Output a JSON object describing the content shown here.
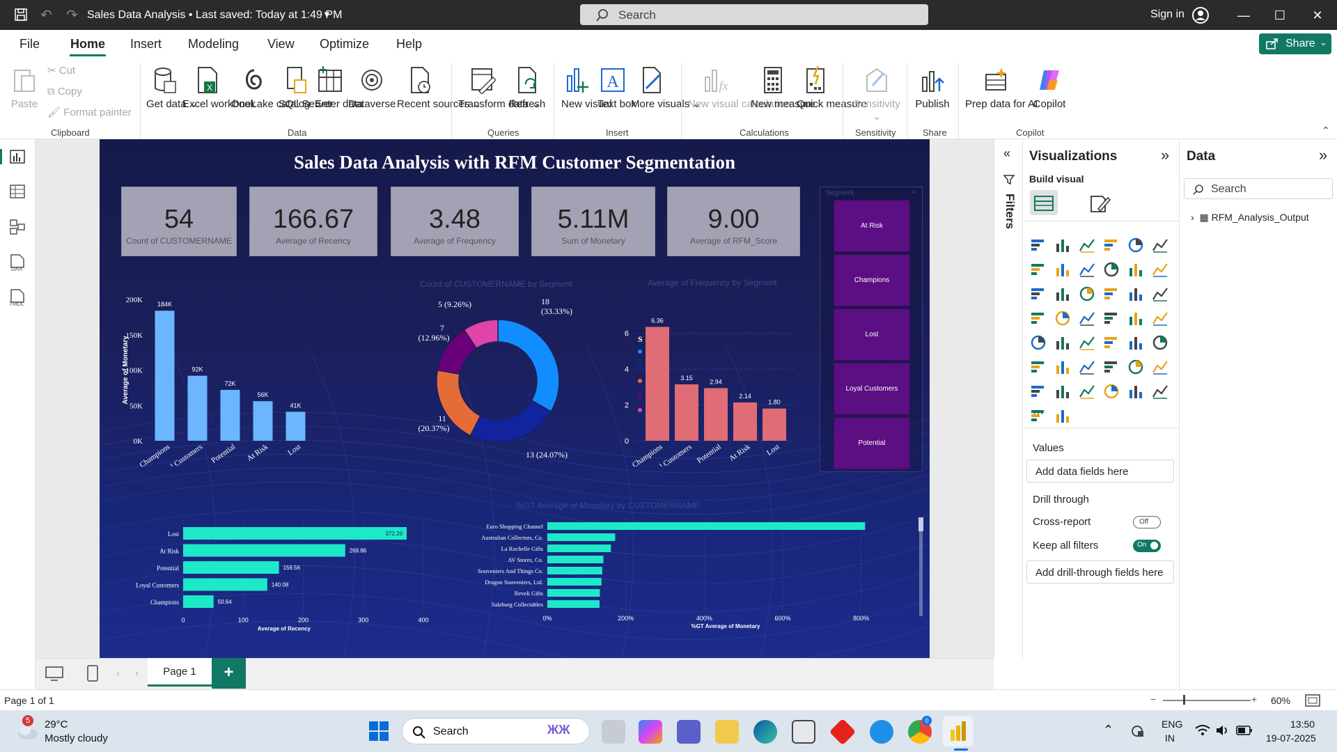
{
  "titlebar": {
    "title": "Sales Data Analysis • Last saved: Today at 1:49 PM",
    "search_placeholder": "Search",
    "sign_in": "Sign in"
  },
  "menu": {
    "items": [
      "File",
      "Home",
      "Insert",
      "Modeling",
      "View",
      "Optimize",
      "Help"
    ],
    "active": "Home",
    "share": "Share"
  },
  "ribbon": {
    "clipboard": {
      "paste": "Paste",
      "cut": "Cut",
      "copy": "Copy",
      "format_painter": "Format painter",
      "group": "Clipboard"
    },
    "data": {
      "get_data": "Get data",
      "excel": "Excel workbook",
      "onelake": "OneLake catalog",
      "sql": "SQL Server",
      "enter": "Enter data",
      "dataverse": "Dataverse",
      "recent": "Recent sources",
      "group": "Data"
    },
    "queries": {
      "transform": "Transform data",
      "refresh": "Refresh",
      "group": "Queries"
    },
    "insert": {
      "new_visual": "New visual",
      "text_box": "Text box",
      "more_visuals": "More visuals",
      "group": "Insert"
    },
    "calculations": {
      "new_visual_calc": "New visual calculation",
      "new_measure": "New measure",
      "quick_measure": "Quick measure",
      "group": "Calculations"
    },
    "sensitivity": {
      "label": "Sensitivity",
      "group": "Sensitivity"
    },
    "share": {
      "publish": "Publish",
      "group": "Share"
    },
    "copilot": {
      "prep": "Prep data for AI",
      "copilot": "Copilot",
      "group": "Copilot"
    }
  },
  "report": {
    "title": "Sales Data Analysis with RFM Customer Segmentation",
    "cards": [
      {
        "value": "54",
        "label": "Count of CUSTOMERNAME"
      },
      {
        "value": "166.67",
        "label": "Average of Recency"
      },
      {
        "value": "3.48",
        "label": "Average of Frequency"
      },
      {
        "value": "5.11M",
        "label": "Sum of Monetary"
      },
      {
        "value": "9.00",
        "label": "Average of RFM_Score"
      }
    ],
    "slicer": {
      "title": "Segment",
      "items": [
        "At Risk",
        "Champions",
        "Lost",
        "Loyal Customers",
        "Potential"
      ]
    }
  },
  "chart_data": [
    {
      "type": "bar",
      "title": "",
      "ylabel": "Average of Monetary",
      "categories": [
        "Champions",
        "Loyal Customers",
        "Potential",
        "At Risk",
        "Lost"
      ],
      "values": [
        184,
        92,
        72,
        56,
        41
      ],
      "data_labels": [
        "184K",
        "92K",
        "72K",
        "56K",
        "41K"
      ],
      "y_ticks": [
        "0K",
        "50K",
        "100K",
        "150K",
        "200K"
      ],
      "ylim": [
        0,
        200
      ],
      "color": "#6cb6ff"
    },
    {
      "type": "pie",
      "title": "Count of CUSTOMERNAME by Segment",
      "legend_title": "Segment",
      "legend_position": "right",
      "categories": [
        "Potential",
        "Loyal Customers",
        "Champions",
        "At Risk",
        "Lost"
      ],
      "values": [
        18,
        13,
        11,
        7,
        5
      ],
      "data_labels": [
        "18 (33.33%)",
        "13 (24.07%)",
        "11 (20.37%)",
        "7 (12.96%)",
        "5 (9.26%)"
      ],
      "colors": [
        "#118dff",
        "#12239e",
        "#e66c37",
        "#6b007b",
        "#e044a7"
      ]
    },
    {
      "type": "bar",
      "title": "Average of Frequency by Segment",
      "categories": [
        "Champions",
        "Loyal Customers",
        "Potential",
        "At Risk",
        "Lost"
      ],
      "values": [
        6.36,
        3.15,
        2.94,
        2.14,
        1.8
      ],
      "data_labels": [
        "6.36",
        "3.15",
        "2.94",
        "2.14",
        "1.80"
      ],
      "y_ticks": [
        "0",
        "2",
        "4",
        "6"
      ],
      "ylim": [
        0,
        7
      ],
      "color": "#e06c75"
    },
    {
      "type": "bar",
      "orientation": "horizontal",
      "xlabel": "Average of Recency",
      "categories": [
        "Lost",
        "At Risk",
        "Potential",
        "Loyal Customers",
        "Champions"
      ],
      "values": [
        372.2,
        269.86,
        159.56,
        140.08,
        50.64
      ],
      "data_labels": [
        "372.20",
        "269.86",
        "159.56",
        "140.08",
        "50.64"
      ],
      "x_ticks": [
        "0",
        "100",
        "200",
        "300",
        "400"
      ],
      "xlim": [
        0,
        400
      ],
      "color": "#1de9c8"
    },
    {
      "type": "bar",
      "orientation": "horizontal",
      "title": "%GT Average of Monetary by CUSTOMERNAME",
      "xlabel": "%GT Average of Monetary",
      "categories": [
        "Euro Shopping Channel",
        "Australian Collectors, Co.",
        "La Rochelle Gifts",
        "AV Stores, Co.",
        "Souveniers And Things Co.",
        "Dragon Souveniers, Ltd.",
        "Reveli Gifts",
        "Salzburg Collectables"
      ],
      "values": [
        810,
        173,
        162,
        143,
        140,
        138,
        134,
        133
      ],
      "x_ticks": [
        "0%",
        "200%",
        "400%",
        "600%",
        "800%"
      ],
      "xlim": [
        0,
        900
      ],
      "color": "#1de9c8"
    }
  ],
  "pages": {
    "tab": "Page 1",
    "status": "Page 1 of 1",
    "zoom": "60%"
  },
  "filters": {
    "label": "Filters"
  },
  "visualizations": {
    "title": "Visualizations",
    "build_visual": "Build visual",
    "values": "Values",
    "add_data_fields": "Add data fields here",
    "drill_through": "Drill through",
    "cross_report": "Cross-report",
    "cross_report_state": "Off",
    "keep_all_filters": "Keep all filters",
    "keep_all_filters_state": "On",
    "add_drill_fields": "Add drill-through fields here"
  },
  "data_pane": {
    "title": "Data",
    "search_placeholder": "Search",
    "table": "RFM_Analysis_Output"
  },
  "taskbar": {
    "weather_badge": "5",
    "temperature": "29°C",
    "weather": "Mostly cloudy",
    "search": "Search",
    "lang1": "ENG",
    "lang2": "IN",
    "time": "13:50",
    "date": "19-07-2025",
    "chrome_badge": "0"
  }
}
